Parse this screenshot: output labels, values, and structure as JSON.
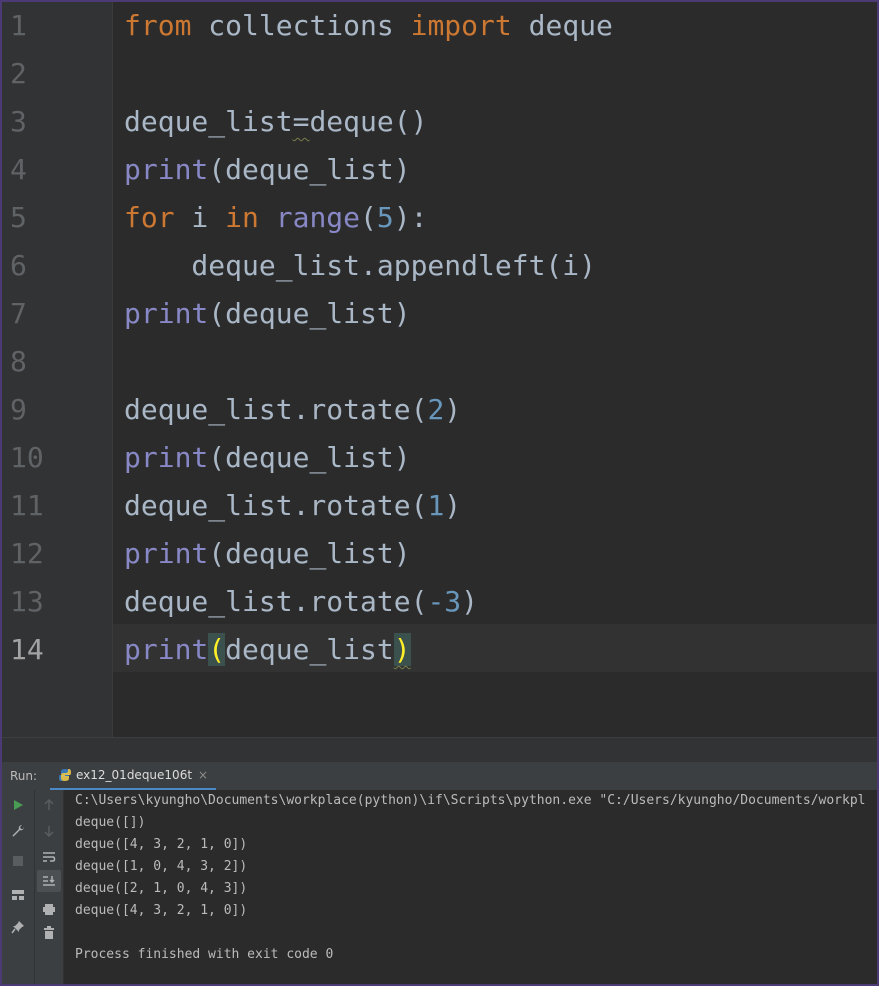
{
  "editor": {
    "line_numbers": [
      "1",
      "2",
      "3",
      "4",
      "5",
      "6",
      "7",
      "8",
      "9",
      "10",
      "11",
      "12",
      "13",
      "14"
    ],
    "current_line": 14
  },
  "code": {
    "l1": {
      "kw_from": "from",
      "module": " collections ",
      "kw_import": "import",
      "name": " deque"
    },
    "l3": {
      "text1": "deque_list",
      "eq": "=",
      "text2": "deque()"
    },
    "l4": {
      "fn": "print",
      "args": "(deque_list)"
    },
    "l5": {
      "kw_for": "for",
      "var": " i ",
      "kw_in": "in",
      "sp": " ",
      "fn": "range",
      "open": "(",
      "num": "5",
      "close": "):"
    },
    "l6": {
      "text1": "    deque_list.appendleft(i)"
    },
    "l7": {
      "fn": "print",
      "args": "(deque_list)"
    },
    "l9": {
      "text1": "deque_list.rotate(",
      "num": "2",
      "close": ")"
    },
    "l10": {
      "fn": "print",
      "args": "(deque_list)"
    },
    "l11": {
      "text1": "deque_list.rotate(",
      "num": "1",
      "close": ")"
    },
    "l12": {
      "fn": "print",
      "args": "(deque_list)"
    },
    "l13": {
      "text1": "deque_list.rotate(",
      "num": "-3",
      "close": ")"
    },
    "l14": {
      "fn": "print",
      "open": "(",
      "mid": "deque_list",
      "close": ")"
    }
  },
  "run_panel": {
    "label": "Run:",
    "tab_label": "ex12_01deque106t",
    "tab_close": "×",
    "icons": [
      "run-icon",
      "wrench-icon",
      "stop-icon",
      "layout-icon",
      "pin-icon",
      "up-arrow-icon",
      "down-arrow-icon",
      "soft-wrap-icon",
      "scroll-to-end-icon",
      "print-icon",
      "trash-icon"
    ]
  },
  "console": {
    "lines": [
      "C:\\Users\\kyungho\\Documents\\workplace(python)\\if\\Scripts\\python.exe \"C:/Users/kyungho/Documents/workpl",
      "deque([])",
      "deque([4, 3, 2, 1, 0])",
      "deque([1, 0, 4, 3, 2])",
      "deque([2, 1, 0, 4, 3])",
      "deque([4, 3, 2, 1, 0])",
      "",
      "Process finished with exit code 0"
    ]
  },
  "colors": {
    "background": "#2b2b2b",
    "keyword": "#cc7832",
    "builtin": "#8888c6",
    "number": "#6897bb",
    "text": "#a9b7c6",
    "brace_match": "#ffef28"
  }
}
